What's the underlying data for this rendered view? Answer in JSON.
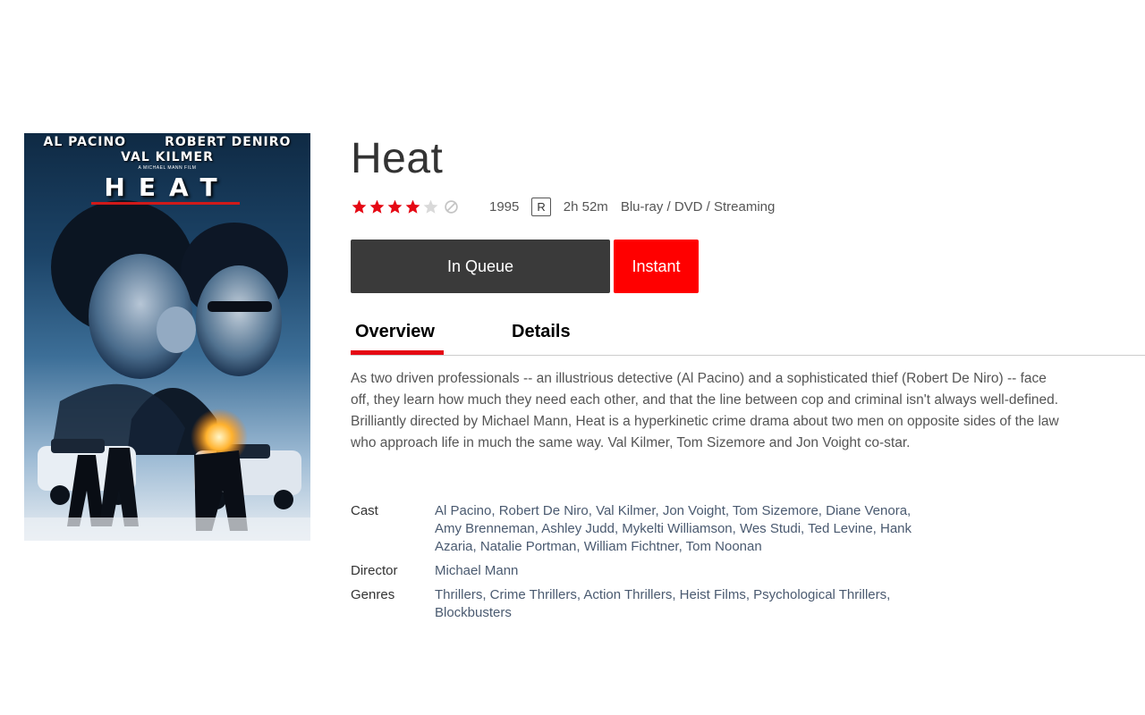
{
  "poster": {
    "actor_1": "AL PACINO",
    "actor_2": "ROBERT DENIRO",
    "actor_3": "VAL KILMER",
    "tagline": "A MICHAEL MANN FILM",
    "title": "HEAT"
  },
  "movie": {
    "title": "Heat",
    "rating_stars": 4,
    "rating_max": 5,
    "year": "1995",
    "mpaa": "R",
    "runtime": "2h 52m",
    "formats": "Blu-ray / DVD / Streaming"
  },
  "actions": {
    "queue_label": "In Queue",
    "instant_label": "Instant"
  },
  "tabs": [
    {
      "label": "Overview",
      "active": true
    },
    {
      "label": "Details",
      "active": false
    }
  ],
  "synopsis": "As two driven professionals -- an illustrious detective (Al Pacino) and a sophisticated thief (Robert De Niro) -- face off, they learn how much they need each other, and that the line between cop and criminal isn't always well-defined. Brilliantly directed by Michael Mann, Heat is a hyperkinetic crime drama about two men on opposite sides of the law who approach life in much the same way. Val Kilmer, Tom Sizemore and Jon Voight co-star.",
  "credits": {
    "cast_label": "Cast",
    "cast": "Al Pacino, Robert De Niro, Val Kilmer, Jon Voight, Tom Sizemore, Diane Venora, Amy Brenneman, Ashley Judd, Mykelti Williamson, Wes Studi, Ted Levine, Hank Azaria, Natalie Portman, William Fichtner, Tom Noonan",
    "director_label": "Director",
    "director": "Michael Mann",
    "genres_label": "Genres",
    "genres": "Thrillers, Crime Thrillers, Action Thrillers, Heist Films, Psychological Thrillers, Blockbusters"
  },
  "colors": {
    "star_filled": "#e50914",
    "star_empty": "#d9d9d9",
    "button_queue": "#3a3a3a",
    "button_instant": "#ff0000",
    "tab_underline": "#e50914"
  },
  "icons": {
    "star": "star-icon",
    "not_interested": "not-interested-icon"
  }
}
